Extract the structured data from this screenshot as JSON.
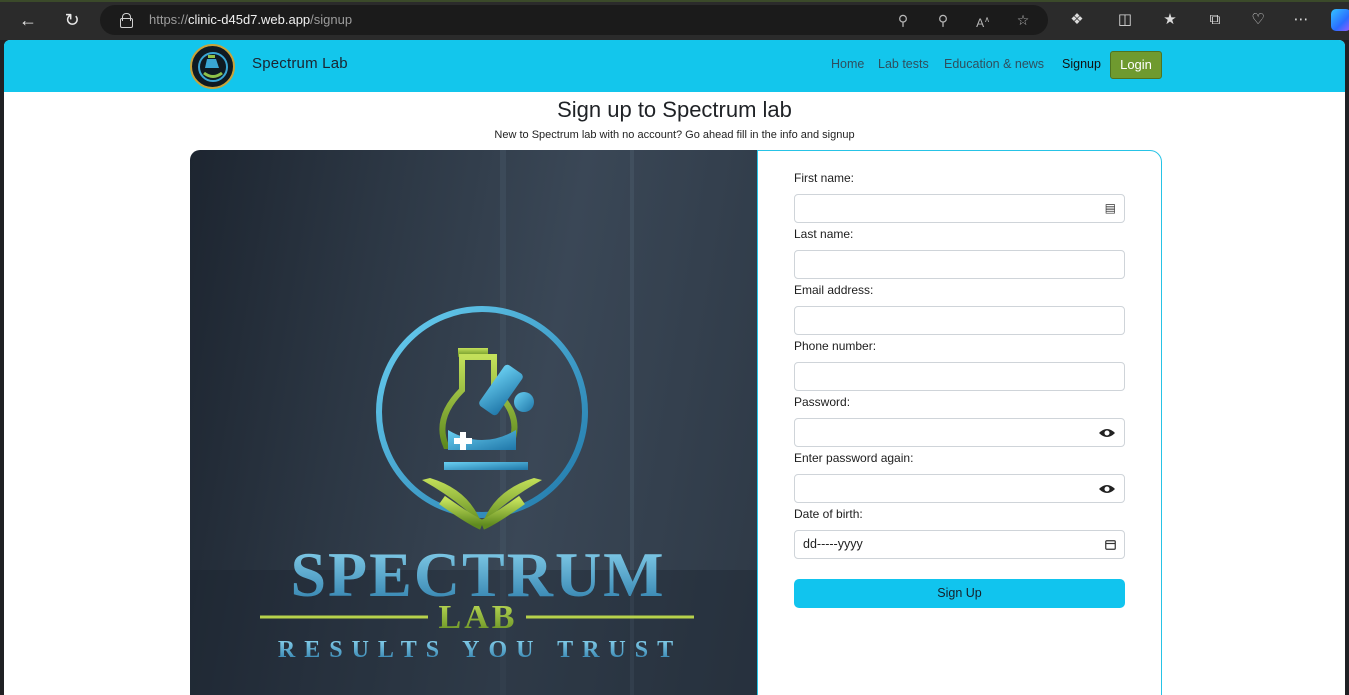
{
  "browser": {
    "url_prefix": "https://",
    "url_host": "clinic-d45d7.web.app",
    "url_path": "/signup",
    "icons": [
      "back-icon",
      "refresh-icon",
      "lock-icon",
      "key-icon",
      "zoom-icon",
      "read-aloud-icon",
      "favorite-star-icon",
      "extensions-icon",
      "split-screen-icon",
      "favorites-icon",
      "collections-icon",
      "health-icon",
      "more-icon",
      "copilot-icon"
    ]
  },
  "nav": {
    "brand": "Spectrum Lab",
    "links": [
      "Home",
      "Lab tests",
      "Education & news",
      "Signup"
    ],
    "login": "Login"
  },
  "heading": {
    "title": "Sign up to Spectrum lab",
    "subtitle": "New to Spectrum lab with no account? Go ahead fill in the info and signup"
  },
  "hero": {
    "word1": "SPECTRUM",
    "word2": "LAB",
    "tagline": "RESULTS YOU TRUST"
  },
  "form": {
    "fields": [
      {
        "label": "First name:",
        "value": ""
      },
      {
        "label": "Last name:",
        "value": ""
      },
      {
        "label": "Email address:",
        "value": ""
      },
      {
        "label": "Phone number:",
        "value": ""
      },
      {
        "label": "Password:",
        "value": ""
      },
      {
        "label": "Enter password again:",
        "value": ""
      },
      {
        "label": "Date of birth:",
        "value": "dd-----yyyy"
      }
    ],
    "submit": "Sign Up"
  },
  "colors": {
    "nav_bg": "#13c6ec",
    "login_bg": "#6f9a2f",
    "button_bg": "#11c4ee",
    "card_border": "#26c3e6"
  }
}
